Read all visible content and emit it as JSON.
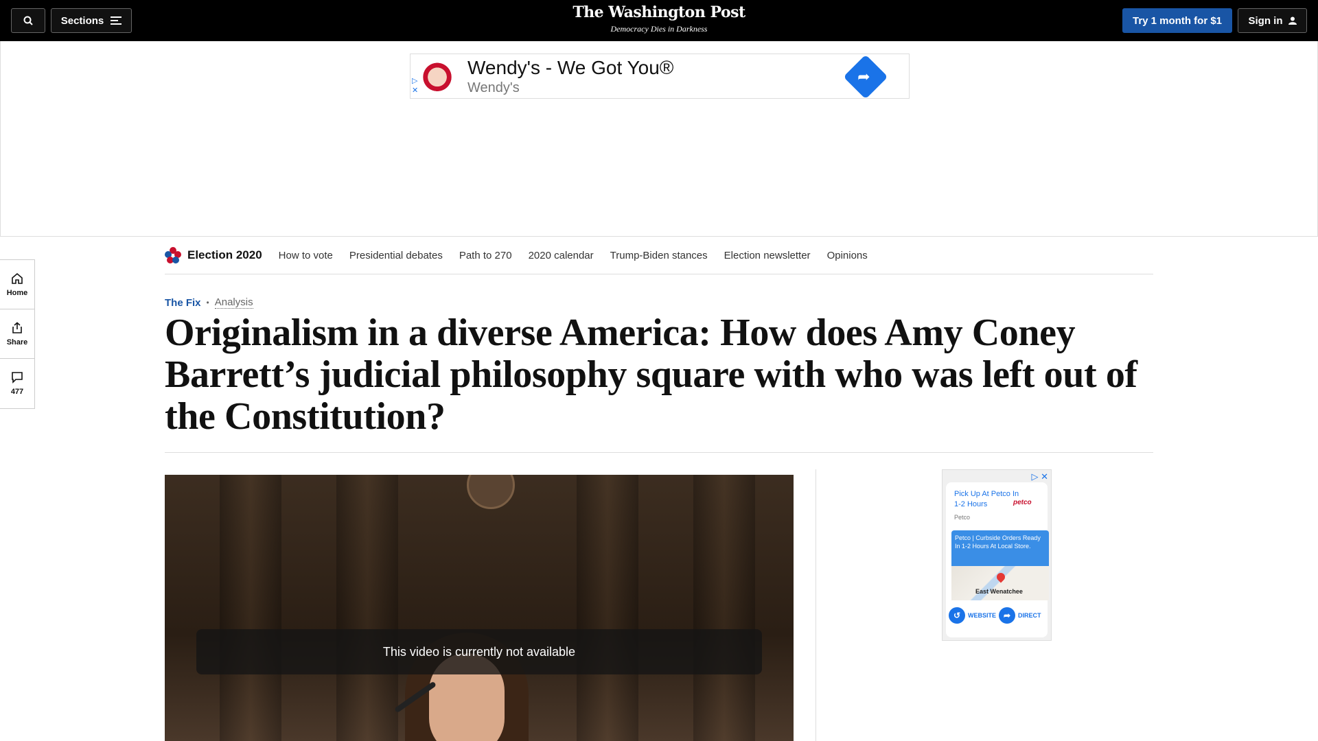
{
  "topbar": {
    "sections_label": "Sections",
    "logo_title": "The Washington Post",
    "logo_tagline": "Democracy Dies in Darkness",
    "trial_label": "Try 1 month for $1",
    "signin_label": "Sign in"
  },
  "top_ad": {
    "title": "Wendy's - We Got You®",
    "advertiser": "Wendy's"
  },
  "election_nav": {
    "title": "Election 2020",
    "links": [
      "How to vote",
      "Presidential debates",
      "Path to 270",
      "2020 calendar",
      "Trump-Biden stances",
      "Election newsletter",
      "Opinions"
    ]
  },
  "rail": {
    "home_label": "Home",
    "share_label": "Share",
    "comments_count": "477"
  },
  "article": {
    "section": "The Fix",
    "label": "Analysis",
    "headline": "Originalism in a diverse America: How does Amy Coney Barrett’s judicial philosophy square with who was left out of the Constitution?"
  },
  "video": {
    "message": "This video is currently not available"
  },
  "side_ad": {
    "headline": "Pick Up At Petco In 1-2 Hours",
    "brand": "petco",
    "source": "Petco",
    "body": "Petco | Curbside Orders Ready In 1-2 Hours At Local Store.",
    "place": "East Wenatchee",
    "website_label": "WEBSITE",
    "directions_label": "DIRECTIONS"
  }
}
